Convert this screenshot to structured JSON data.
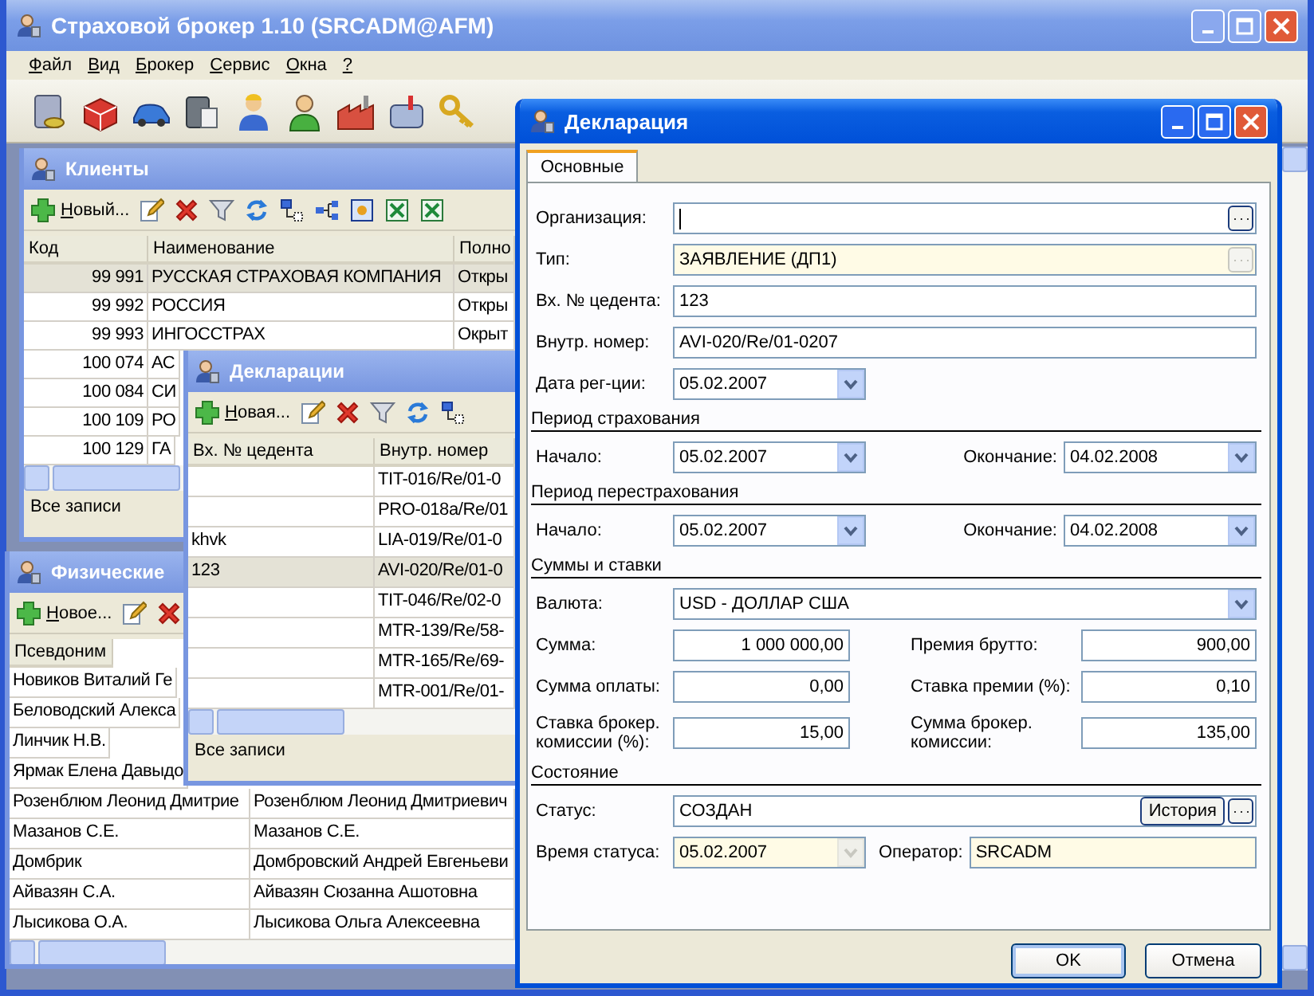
{
  "window": {
    "title": "Страховой брокер 1.10 (SRCADM@AFM)"
  },
  "menu": [
    {
      "label": "Файл"
    },
    {
      "label": "Вид"
    },
    {
      "label": "Брокер"
    },
    {
      "label": "Сервис"
    },
    {
      "label": "Окна"
    },
    {
      "label": "?"
    }
  ],
  "clients": {
    "title": "Клиенты",
    "new_button": "Новый...",
    "columns": [
      "Код",
      "Наименование",
      "Полно"
    ],
    "rows": [
      {
        "cells": [
          "99 991",
          "РУССКАЯ СТРАХОВАЯ КОМПАНИЯ",
          "Откры"
        ],
        "selected": true
      },
      {
        "cells": [
          "99 992",
          "РОССИЯ",
          "Откры"
        ],
        "selected": false
      },
      {
        "cells": [
          "99 993",
          "ИНГОССТРАХ",
          "Окрыт"
        ],
        "selected": false
      },
      {
        "cells": [
          "100 074",
          "АС"
        ],
        "selected": false
      },
      {
        "cells": [
          "100 084",
          "СИ"
        ],
        "selected": false
      },
      {
        "cells": [
          "100 109",
          "РО"
        ],
        "selected": false
      },
      {
        "cells": [
          "100 129",
          "ГА"
        ],
        "selected": false
      }
    ],
    "status": "Все записи"
  },
  "persons": {
    "title": "Физические",
    "new_button": "Новое...",
    "columns": [
      "Псевдоним"
    ],
    "rows": [
      {
        "cells": [
          "Новиков Виталий Ге"
        ],
        "selected": false
      },
      {
        "cells": [
          "Беловодский Алекса"
        ],
        "selected": false
      },
      {
        "cells": [
          "Линчик Н.В."
        ],
        "selected": false
      },
      {
        "cells": [
          "Ярмак Елена Давыдо"
        ],
        "selected": false
      },
      {
        "cells": [
          "Розенблюм Леонид Дмитрие",
          "Розенблюм Леонид Дмитриевич"
        ],
        "selected": false
      },
      {
        "cells": [
          "Мазанов С.Е.",
          "Мазанов С.Е."
        ],
        "selected": false
      },
      {
        "cells": [
          "Домбрик",
          "Домбровский Андрей Евгеньеви"
        ],
        "selected": false
      },
      {
        "cells": [
          "Айвазян С.А.",
          "Айвазян Сюзанна Ашотовна"
        ],
        "selected": false
      },
      {
        "cells": [
          "Лысикова О.А.",
          "Лысикова Ольга Алексеевна"
        ],
        "selected": false
      }
    ]
  },
  "declarations": {
    "title": "Декларации",
    "new_button": "Новая...",
    "columns": [
      "Вх. № цедента",
      "Внутр. номер"
    ],
    "rows": [
      {
        "cells": [
          "",
          "TIT-016/Re/01-0"
        ],
        "selected": false
      },
      {
        "cells": [
          "",
          "PRO-018a/Re/01"
        ],
        "selected": false
      },
      {
        "cells": [
          "khvk",
          "LIA-019/Re/01-0"
        ],
        "selected": false
      },
      {
        "cells": [
          "123",
          "AVI-020/Re/01-0"
        ],
        "selected": true
      },
      {
        "cells": [
          "",
          "TIT-046/Re/02-0"
        ],
        "selected": false
      },
      {
        "cells": [
          "",
          "MTR-139/Re/58-"
        ],
        "selected": false
      },
      {
        "cells": [
          "",
          "MTR-165/Re/69-"
        ],
        "selected": false
      },
      {
        "cells": [
          "",
          "MTR-001/Re/01-"
        ],
        "selected": false
      }
    ],
    "status": "Все записи"
  },
  "dialog": {
    "title": "Декларация",
    "tabs": [
      {
        "label": "Основные",
        "selected": true
      }
    ],
    "rows": [
      {
        "kind": "field",
        "field": {
          "label": "Организация:",
          "kind": "lookup",
          "readonly": false,
          "focused": true
        }
      },
      {
        "kind": "field",
        "field": {
          "label": "Тип:",
          "value": "ЗАЯВЛЕНИЕ (ДП1)",
          "kind": "lookup",
          "readonly": true
        }
      },
      {
        "kind": "field",
        "field": {
          "label": "Вх. № цедента:",
          "value": "123",
          "kind": "text",
          "readonly": false
        }
      },
      {
        "kind": "field",
        "field": {
          "label": "Внутр. номер:",
          "value": "AVI-020/Re/01-0207",
          "kind": "text",
          "readonly": false
        }
      },
      {
        "kind": "single",
        "field": {
          "label": "Дата рег-ции:",
          "value": "05.02.2007",
          "kind": "date",
          "readonly": false
        }
      },
      {
        "kind": "section",
        "title": "Период страхования"
      },
      {
        "kind": "pair",
        "left": {
          "label": "Начало:",
          "value": "05.02.2007",
          "kind": "date",
          "readonly": false
        },
        "right": {
          "label": "Окончание:",
          "value": "04.02.2008",
          "kind": "date",
          "readonly": false
        }
      },
      {
        "kind": "section",
        "title": "Период перестрахования"
      },
      {
        "kind": "pair",
        "left": {
          "label": "Начало:",
          "value": "05.02.2007",
          "kind": "date",
          "readonly": false
        },
        "right": {
          "label": "Окончание:",
          "value": "04.02.2008",
          "kind": "date",
          "readonly": false
        }
      },
      {
        "kind": "section",
        "title": "Суммы и ставки"
      },
      {
        "kind": "field",
        "field": {
          "label": "Валюта:",
          "value": "USD - ДОЛЛАР США",
          "kind": "combo",
          "readonly": false
        }
      },
      {
        "kind": "pair",
        "left": {
          "label": "Сумма:",
          "value": "1 000 000,00",
          "kind": "number",
          "readonly": false
        },
        "right": {
          "label": "Премия брутто:",
          "value": "900,00",
          "kind": "number",
          "readonly": false
        }
      },
      {
        "kind": "pair",
        "left": {
          "label": "Сумма оплаты:",
          "value": "0,00",
          "kind": "number",
          "readonly": false
        },
        "right": {
          "label": "Ставка премии (%):",
          "value": "0,10",
          "kind": "number",
          "readonly": false
        }
      },
      {
        "kind": "pair",
        "left": {
          "label": "Ставка брокер. комиссии (%):",
          "value": "15,00",
          "kind": "number",
          "readonly": false
        },
        "right": {
          "label": "Сумма брокер. комиссии:",
          "value": "135,00",
          "kind": "number",
          "readonly": false
        }
      },
      {
        "kind": "section",
        "title": "Состояние"
      },
      {
        "kind": "field",
        "field": {
          "label": "Статус:",
          "value": "СОЗДАН",
          "kind": "status",
          "readonly": false,
          "button": "История"
        }
      },
      {
        "kind": "pair",
        "left": {
          "label": "Время статуса:",
          "value": "05.02.2007",
          "kind": "date",
          "readonly": true
        },
        "right": {
          "label": "Оператор:",
          "value": "SRCADM",
          "kind": "text",
          "readonly": true
        }
      }
    ],
    "buttons": [
      "OK",
      "Отмена"
    ]
  }
}
